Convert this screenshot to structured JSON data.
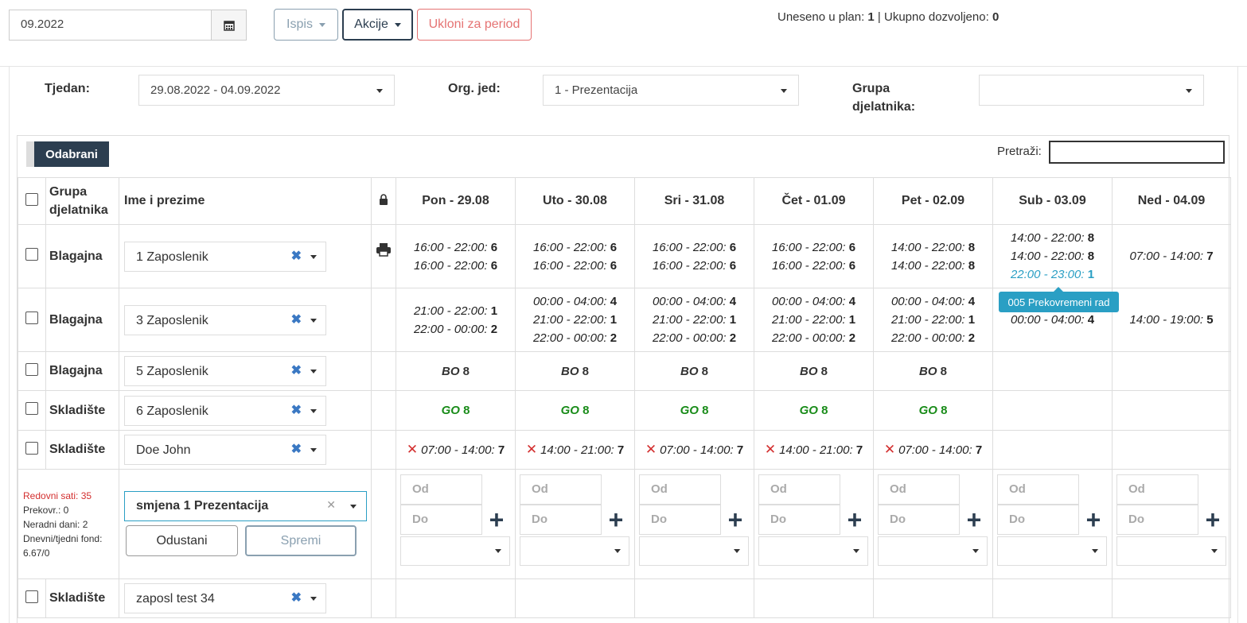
{
  "top": {
    "month_value": "09.2022",
    "ispis_label": "Ispis",
    "akcije_label": "Akcije",
    "ukloni_label": "Ukloni za period",
    "plan_label": "Uneseno u plan:",
    "plan_value": "1",
    "allowed_label": "Ukupno dozvoljeno:",
    "allowed_value": "0"
  },
  "filters": {
    "tjedan_label": "Tjedan:",
    "tjedan_value": "29.08.2022 - 04.09.2022",
    "org_label": "Org. jed:",
    "org_value": "1 - Prezentacija",
    "grupa_label_1": "Grupa",
    "grupa_label_2": "djelatnika:",
    "grupa_value": ""
  },
  "toolbar": {
    "odabrani_label": "Odabrani",
    "search_label": "Pretraži:"
  },
  "table": {
    "h_group_1": "Grupa",
    "h_group_2": "djelatnika",
    "h_name": "Ime i prezime",
    "days": [
      "Pon - 29.08",
      "Uto - 30.08",
      "Sri - 31.08",
      "Čet - 01.09",
      "Pet - 02.09",
      "Sub - 03.09",
      "Ned - 04.09"
    ],
    "rows": [
      {
        "group": "Blagajna",
        "name": "1 Zaposlenik"
      },
      {
        "group": "Blagajna",
        "name": "3 Zaposlenik"
      },
      {
        "group": "Blagajna",
        "name": "5 Zaposlenik"
      },
      {
        "group": "Skladište",
        "name": "6 Zaposlenik"
      },
      {
        "group": "Skladište",
        "name": "Doe John"
      },
      {
        "group": "Skladište",
        "name": "zaposl test 34"
      }
    ],
    "r1": {
      "d1": [
        [
          "16:00 - 22:00:",
          "6"
        ],
        [
          "16:00 - 22:00:",
          "6"
        ]
      ],
      "d2": [
        [
          "16:00 - 22:00:",
          "6"
        ],
        [
          "16:00 - 22:00:",
          "6"
        ]
      ],
      "d3": [
        [
          "16:00 - 22:00:",
          "6"
        ],
        [
          "16:00 - 22:00:",
          "6"
        ]
      ],
      "d4": [
        [
          "16:00 - 22:00:",
          "6"
        ],
        [
          "16:00 - 22:00:",
          "6"
        ]
      ],
      "d5": [
        [
          "14:00 - 22:00:",
          "8"
        ],
        [
          "14:00 - 22:00:",
          "8"
        ]
      ],
      "d6": [
        [
          "14:00 - 22:00:",
          "8"
        ],
        [
          "14:00 - 22:00:",
          "8"
        ],
        [
          "22:00 - 23:00:",
          "1"
        ]
      ],
      "d7": [
        [
          "07:00 - 14:00:",
          "7"
        ]
      ]
    },
    "r2": {
      "d1": [
        [
          "21:00 - 22:00:",
          "1"
        ],
        [
          "22:00 - 00:00:",
          "2"
        ]
      ],
      "d2": [
        [
          "00:00 - 04:00:",
          "4"
        ],
        [
          "21:00 - 22:00:",
          "1"
        ],
        [
          "22:00 - 00:00:",
          "2"
        ]
      ],
      "d3": [
        [
          "00:00 - 04:00:",
          "4"
        ],
        [
          "21:00 - 22:00:",
          "1"
        ],
        [
          "22:00 - 00:00:",
          "2"
        ]
      ],
      "d4": [
        [
          "00:00 - 04:00:",
          "4"
        ],
        [
          "21:00 - 22:00:",
          "1"
        ],
        [
          "22:00 - 00:00:",
          "2"
        ]
      ],
      "d5": [
        [
          "00:00 - 04:00:",
          "4"
        ],
        [
          "21:00 - 22:00:",
          "1"
        ],
        [
          "22:00 - 00:00:",
          "2"
        ]
      ],
      "d6": [
        [
          "00:00 - 04:00:",
          "4"
        ]
      ],
      "d7": [
        [
          "14:00 - 19:00:",
          "5"
        ]
      ]
    },
    "tooltip": "005 Prekovremeni rad",
    "bo_label": "BO",
    "bo_hours": "8",
    "go_label": "GO",
    "go_hours": "8",
    "r5": [
      [
        "07:00 - 14:00:",
        "7"
      ],
      [
        "14:00 - 21:00:",
        "7"
      ],
      [
        "07:00 - 14:00:",
        "7"
      ],
      [
        "14:00 - 21:00:",
        "7"
      ],
      [
        "07:00 - 14:00:",
        "7"
      ]
    ],
    "summary": {
      "redovni": "Redovni sati: 35",
      "prekovr": "Prekovr.: 0",
      "neradni": "Neradni dani: 2",
      "fond_label": "Dnevni/tjedni fond:",
      "fond_value": "6.67/0"
    },
    "editor": {
      "shift_value": "smjena 1 Prezentacija",
      "odustani": "Odustani",
      "spremi": "Spremi",
      "od_placeholder": "Od",
      "do_placeholder": "Do"
    }
  }
}
